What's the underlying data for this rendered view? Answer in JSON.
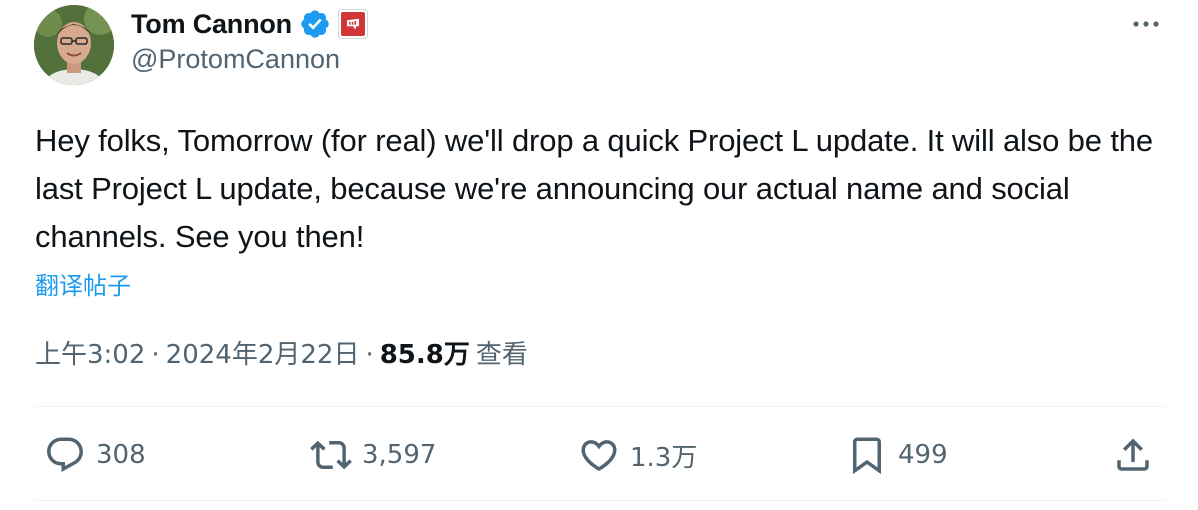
{
  "author": {
    "display_name": "Tom Cannon",
    "handle": "@ProtomCannon",
    "verified": true,
    "verified_color": "#1d9bf0",
    "affiliation_badge_color": "#d13639"
  },
  "tweet": {
    "text": "Hey folks, Tomorrow (for real) we'll drop a quick Project L update. It will also be the last Project L update, because we're announcing our actual name and social channels. See you then!",
    "translate_label": "翻译帖子",
    "time": "上午3:02",
    "date": "2024年2月22日",
    "separator": "·",
    "views_count": "85.8万",
    "views_label": "查看"
  },
  "actions": {
    "replies": "308",
    "retweets": "3,597",
    "likes": "1.3万",
    "bookmarks": "499"
  },
  "icons": {
    "more": "more-horizontal-icon",
    "reply": "reply-icon",
    "retweet": "retweet-icon",
    "like": "heart-icon",
    "bookmark": "bookmark-icon",
    "share": "share-icon"
  },
  "colors": {
    "text": "#0f1419",
    "secondary": "#536471",
    "link": "#1d9bf0",
    "divider": "#eff3f4"
  }
}
